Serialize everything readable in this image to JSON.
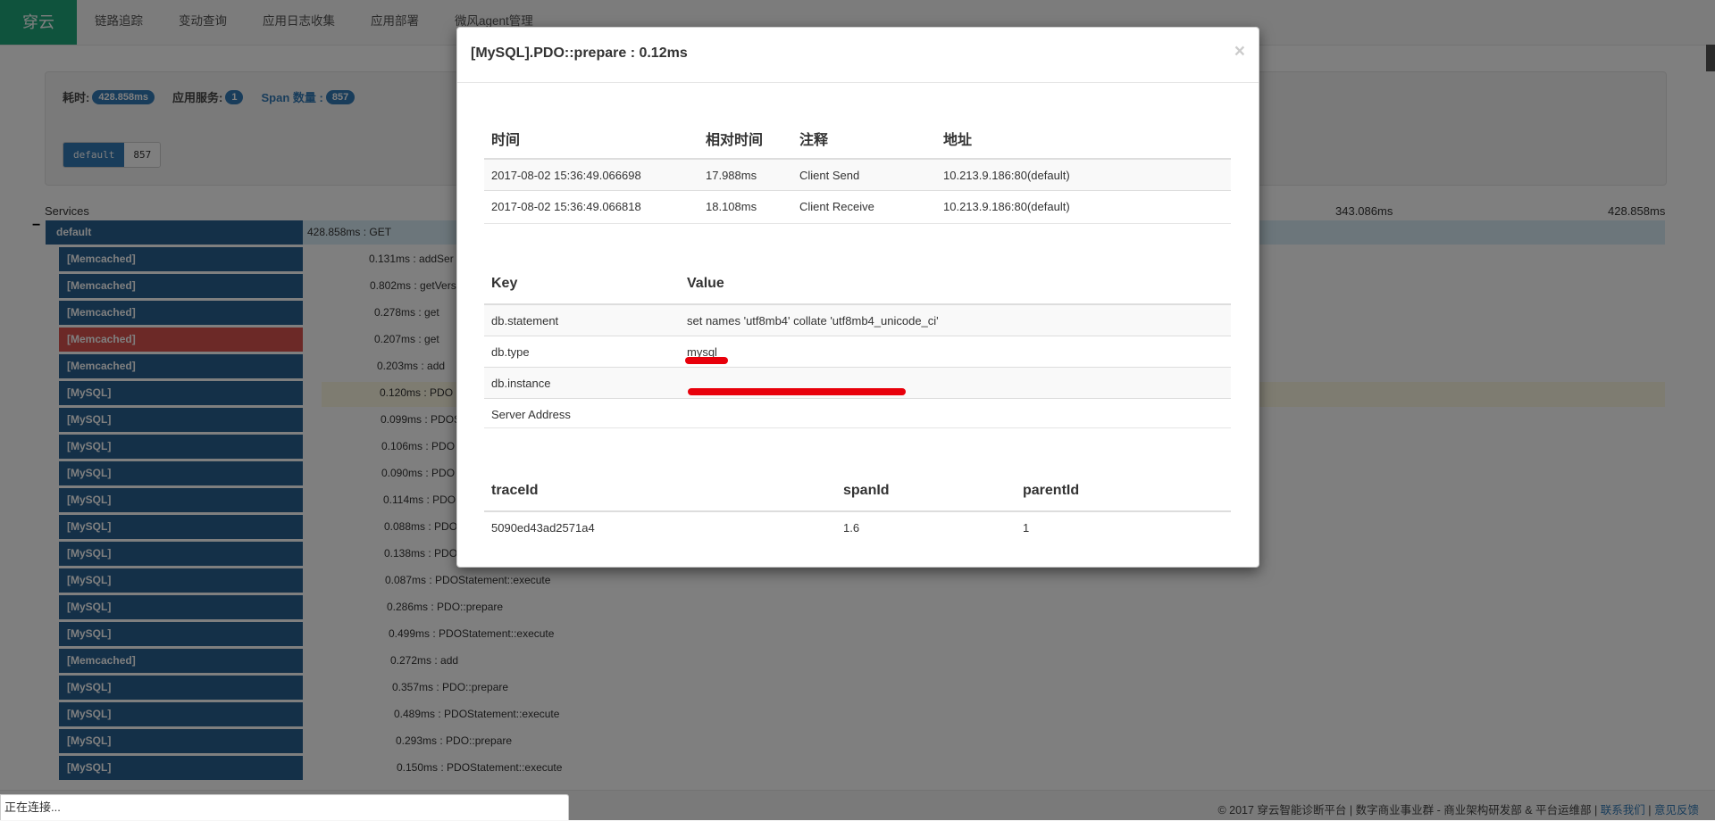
{
  "navbar": {
    "brand": "穿云",
    "items": [
      "链路追踪",
      "变动查询",
      "应用日志收集",
      "应用部署",
      "微风agent管理"
    ]
  },
  "summary": {
    "duration_label": "耗时:",
    "duration_value": "428.858ms",
    "services_label": "应用服务:",
    "services_value": "1",
    "span_label": "Span 数量 :",
    "span_value": "857",
    "service_button": "default",
    "service_count": "857"
  },
  "trace": {
    "services_header": "Services",
    "ticks": [
      "343.086ms",
      "428.858ms"
    ],
    "collapse_sign": "−",
    "root": {
      "label": "default",
      "text": "428.858ms : GET"
    },
    "spans": [
      {
        "label": "[Memcached]",
        "text": "0.131ms : addSer",
        "error": false
      },
      {
        "label": "[Memcached]",
        "text": "0.802ms : getVers",
        "error": false
      },
      {
        "label": "[Memcached]",
        "text": "0.278ms : get",
        "error": false
      },
      {
        "label": "[Memcached]",
        "text": "0.207ms : get",
        "error": true
      },
      {
        "label": "[Memcached]",
        "text": "0.203ms : add",
        "error": false
      },
      {
        "label": "[MySQL]",
        "text": "0.120ms : PDO",
        "error": false
      },
      {
        "label": "[MySQL]",
        "text": "0.099ms : PDOS",
        "error": false
      },
      {
        "label": "[MySQL]",
        "text": "0.106ms : PDO",
        "error": false
      },
      {
        "label": "[MySQL]",
        "text": "0.090ms : PDO",
        "error": false
      },
      {
        "label": "[MySQL]",
        "text": "0.114ms : PDO",
        "error": false
      },
      {
        "label": "[MySQL]",
        "text": "0.088ms : PDO",
        "error": false
      },
      {
        "label": "[MySQL]",
        "text": "0.138ms : PDO",
        "error": false
      },
      {
        "label": "[MySQL]",
        "text": "0.087ms : PDOStatement::execute",
        "error": false
      },
      {
        "label": "[MySQL]",
        "text": "0.286ms : PDO::prepare",
        "error": false
      },
      {
        "label": "[MySQL]",
        "text": "0.499ms : PDOStatement::execute",
        "error": false
      },
      {
        "label": "[Memcached]",
        "text": "0.272ms : add",
        "error": false
      },
      {
        "label": "[MySQL]",
        "text": "0.357ms : PDO::prepare",
        "error": false
      },
      {
        "label": "[MySQL]",
        "text": "0.489ms : PDOStatement::execute",
        "error": false
      },
      {
        "label": "[MySQL]",
        "text": "0.293ms : PDO::prepare",
        "error": false
      },
      {
        "label": "[MySQL]",
        "text": "0.150ms : PDOStatement::execute",
        "error": false
      }
    ]
  },
  "modal": {
    "title": "[MySQL].PDO::prepare : 0.12ms",
    "close": "×",
    "annotations": {
      "headers": [
        "时间",
        "相对时间",
        "注释",
        "地址"
      ],
      "rows": [
        [
          "2017-08-02 15:36:49.066698",
          "17.988ms",
          "Client Send",
          "10.213.9.186:80(default)"
        ],
        [
          "2017-08-02 15:36:49.066818",
          "18.108ms",
          "Client Receive",
          "10.213.9.186:80(default)"
        ]
      ]
    },
    "tags": {
      "headers": [
        "Key",
        "Value"
      ],
      "rows": [
        [
          "db.statement",
          "set names 'utf8mb4' collate 'utf8mb4_unicode_ci'"
        ],
        [
          "db.type",
          "mysql"
        ],
        [
          "db.instance",
          ""
        ],
        [
          "Server Address",
          ""
        ]
      ]
    },
    "ids": {
      "headers": [
        "traceId",
        "spanId",
        "parentId"
      ],
      "rows": [
        [
          "5090ed43ad2571a4",
          "1.6",
          "1"
        ]
      ]
    }
  },
  "footer": {
    "text": "© 2017 穿云智能诊断平台 | 数字商业事业群 - 商业架构研发部 & 平台运维部",
    "contact": "联系我们",
    "feedback": "意见反馈"
  },
  "status_bar": "正在连接...",
  "colors": {
    "brand": "#1fa67a",
    "span": "#286090",
    "error": "#d9534f",
    "redaction": "#e8000b"
  }
}
